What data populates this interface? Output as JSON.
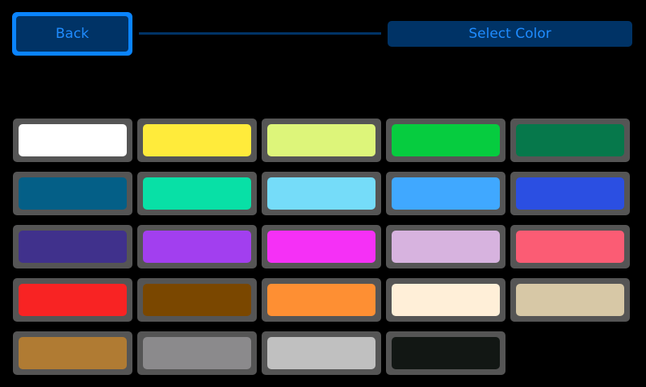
{
  "header": {
    "back_label": "Back",
    "title": "Select Color"
  },
  "theme": {
    "background": "#000000",
    "back_border": "#0a84ff",
    "back_fill": "#003366",
    "accent_text": "#1f8cff",
    "title_fill": "#003366",
    "line": "#003366",
    "swatch_frame": "#555555"
  },
  "swatches": [
    "#ffffff",
    "#ffeb3b",
    "#ddf57a",
    "#06cc3f",
    "#06784b",
    "#045f87",
    "#08e0a6",
    "#75dcf9",
    "#40a8ff",
    "#2b4fe2",
    "#40318c",
    "#a23fef",
    "#f530f6",
    "#d7b3df",
    "#fb5c74",
    "#f82323",
    "#7a4700",
    "#fe8f33",
    "#ffefd8",
    "#d7c8a6",
    "#b07b33",
    "#8b8a8c",
    "#c0c0c0",
    "#121714"
  ]
}
